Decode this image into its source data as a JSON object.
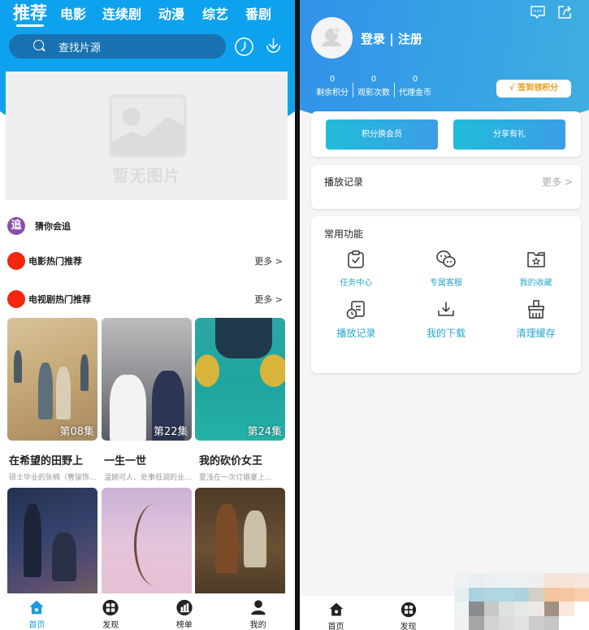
{
  "left": {
    "tabs": [
      {
        "label": "推荐",
        "active": true
      },
      {
        "label": "电影",
        "active": false
      },
      {
        "label": "连续剧",
        "active": false
      },
      {
        "label": "动漫",
        "active": false
      },
      {
        "label": "综艺",
        "active": false
      },
      {
        "label": "番剧",
        "active": false
      }
    ],
    "search": {
      "placeholder": "查找片源",
      "icon": "search-icon"
    },
    "header_icons": [
      "history-clock-icon",
      "download-icon"
    ],
    "banner": {
      "placeholder_text": "暂无图片",
      "icon": "image-placeholder-icon"
    },
    "sections": [
      {
        "badge": "追",
        "title": "猜你会追",
        "more": ""
      },
      {
        "badge": "",
        "title": "电影热门推荐",
        "more": "更多 >"
      },
      {
        "badge": "",
        "title": "电视剧热门推荐",
        "more": "更多 >"
      }
    ],
    "videos": [
      {
        "title": "在希望的田野上",
        "desc": "硕士毕业的张楠（曹骏饰...",
        "episode": "第08集"
      },
      {
        "title": "一生一世",
        "desc": "温婉可人、处事低调的业...",
        "episode": "第22集"
      },
      {
        "title": "我的砍价女王",
        "desc": "夏浅在一次订婚宴上...",
        "episode": "第24集"
      },
      {
        "title": "",
        "desc": "",
        "episode": ""
      },
      {
        "title": "",
        "desc": "",
        "episode": ""
      },
      {
        "title": "",
        "desc": "",
        "episode": ""
      }
    ],
    "bottom_nav": [
      {
        "label": "首页",
        "icon": "home-icon",
        "active": true
      },
      {
        "label": "发现",
        "icon": "discover-icon",
        "active": false
      },
      {
        "label": "榜单",
        "icon": "ranking-icon",
        "active": false
      },
      {
        "label": "我的",
        "icon": "profile-icon",
        "active": false
      }
    ],
    "colors": {
      "primary": "#0ea2ee",
      "search_bg": "#1872b2",
      "active_nav": "#1a9be0",
      "badge_red": "#f5260e",
      "badge_purple": "#8b4fa8"
    }
  },
  "right": {
    "header_icons": [
      "message-icon",
      "share-icon"
    ],
    "user": {
      "login_label": "登录 | 注册"
    },
    "stats": [
      {
        "value": "0",
        "label": "剩余积分"
      },
      {
        "value": "0",
        "label": "观影次数"
      },
      {
        "value": "0",
        "label": "代理金币"
      }
    ],
    "signin_button": "√ 签到领积分",
    "action_buttons": [
      "积分换会员",
      "分享有礼"
    ],
    "history": {
      "title": "播放记录",
      "more": "更多 >"
    },
    "functions": {
      "title": "常用功能",
      "items": [
        {
          "label": "任务中心",
          "icon": "task-clipboard-icon"
        },
        {
          "label": "专属客服",
          "icon": "chat-service-icon"
        },
        {
          "label": "我的收藏",
          "icon": "favorite-folder-icon"
        },
        {
          "label": "播放记录",
          "icon": "play-history-icon"
        },
        {
          "label": "我的下载",
          "icon": "download-tray-icon"
        },
        {
          "label": "清理缓存",
          "icon": "clear-cache-brush-icon"
        }
      ]
    },
    "bottom_nav": [
      {
        "label": "首页",
        "icon": "home-icon"
      },
      {
        "label": "发现",
        "icon": "discover-icon"
      }
    ],
    "colors": {
      "header_start": "#2f86e9",
      "header_end": "#43b4dd",
      "signin_text": "#e6a01a",
      "function_label": "#28a6cc"
    }
  }
}
